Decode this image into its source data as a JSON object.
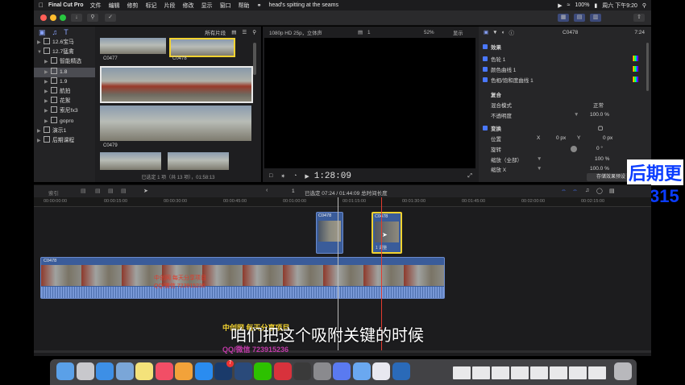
{
  "menubar": {
    "app_name": "Final Cut Pro",
    "menus": [
      "文件",
      "编辑",
      "修剪",
      "标记",
      "片段",
      "修改",
      "显示",
      "窗口",
      "帮助"
    ],
    "now_playing": "head's spitting at the seams",
    "battery": "100%",
    "clock": "周六 下午9:20"
  },
  "sidebar": {
    "items": [
      {
        "label": "12.6宝马",
        "depth": 0,
        "expanded": false,
        "selected": false
      },
      {
        "label": "12.7猛禽",
        "depth": 0,
        "expanded": true,
        "selected": false
      },
      {
        "label": "智能精选",
        "depth": 1,
        "expanded": false,
        "selected": false
      },
      {
        "label": "1.8",
        "depth": 1,
        "expanded": false,
        "selected": true
      },
      {
        "label": "1.9",
        "depth": 1,
        "expanded": false,
        "selected": false
      },
      {
        "label": "航拍",
        "depth": 1,
        "expanded": false,
        "selected": false
      },
      {
        "label": "花絮",
        "depth": 1,
        "expanded": false,
        "selected": false
      },
      {
        "label": "索尼fx3",
        "depth": 1,
        "expanded": false,
        "selected": false
      },
      {
        "label": "gopro",
        "depth": 1,
        "expanded": false,
        "selected": false
      },
      {
        "label": "演示1",
        "depth": 0,
        "expanded": false,
        "selected": false
      },
      {
        "label": "后期课程",
        "depth": 0,
        "expanded": false,
        "selected": false
      }
    ]
  },
  "browser": {
    "filter": "所有片段",
    "clips": [
      {
        "name": "C0477"
      },
      {
        "name": "C0478"
      },
      {
        "name": "C0479"
      }
    ],
    "status": "已选定 1 项（共 13 项），01:58:13"
  },
  "viewer": {
    "format": "1080p HD 25p，立体声",
    "clip_index": "1",
    "zoom": "52%",
    "view_menu": "显示",
    "timecode": "1:28:09"
  },
  "inspector": {
    "clip_name": "C0478",
    "duration": "7:24",
    "effects_title": "效果",
    "effects": [
      "色轮 1",
      "颜色曲线 1",
      "色相/饱和度曲线 1"
    ],
    "composite_title": "复合",
    "blend_mode_label": "混合模式",
    "blend_mode_value": "正常",
    "opacity_label": "不透明度",
    "opacity_value": "100.0 %",
    "transform_title": "变换",
    "position_label": "位置",
    "position_x_label": "X",
    "position_x": "0 px",
    "position_y_label": "Y",
    "position_y": "0 px",
    "rotation_label": "旋转",
    "rotation_value": "0 °",
    "scale_all_label": "缩放（全部）",
    "scale_all_value": "100 %",
    "scale_x_label": "缩放 X",
    "scale_x_value": "100.0 %",
    "save_preset_label": "存储效果预设"
  },
  "timeline_bar": {
    "index_label": "索引",
    "page": "1",
    "selection_info": "已选定 07:24 / 01:44:09 总时间长度"
  },
  "ruler": {
    "ticks": [
      "00:00:00:00",
      "00:00:15:00",
      "00:00:30:00",
      "00:00:45:00",
      "00:01:00:00",
      "00:01:15:00",
      "00:01:30:00",
      "00:01:45:00",
      "00:02:00:00",
      "00:02:15:00"
    ]
  },
  "timeline": {
    "connected_clips": [
      {
        "name": "C0478"
      },
      {
        "name": "C0478",
        "subtitle": "1 调整"
      }
    ],
    "primary_clip": {
      "name": "C0478"
    }
  },
  "overlay": {
    "subtitle": "咱们把这个吸附关键的时候",
    "watermark_top": "中创网 每天分享项目",
    "watermark_bottom": "QQ/微信 723915236",
    "clip_watermark_1": "中创网 每天分享项目",
    "clip_watermark_2": "QQ/微信 723915236",
    "promo_top": "后期更",
    "promo_bottom": "315"
  },
  "colors": {
    "accent": "#4a78ff",
    "selection_yellow": "#f2d230",
    "clip_blue": "#3a5c9a",
    "playhead_red": "#e23b2e"
  },
  "dock": {
    "icons": [
      "finder-icon",
      "launchpad-icon",
      "safari-icon",
      "preview-icon",
      "notes-icon",
      "music-icon",
      "photos-icon",
      "app-store-icon",
      "photoshop-icon",
      "lightroom-icon",
      "wechat-icon",
      "netease-music-icon",
      "final-cut-icon",
      "system-preferences-icon",
      "cloud-icon",
      "transfer-icon",
      "youku-icon",
      "quicktime-icon",
      "window-thumbnail",
      "window-thumbnail",
      "window-thumbnail",
      "window-thumbnail",
      "window-thumbnail",
      "window-thumbnail",
      "window-thumbnail",
      "window-thumbnail",
      "trash-icon"
    ],
    "badge": "7"
  }
}
